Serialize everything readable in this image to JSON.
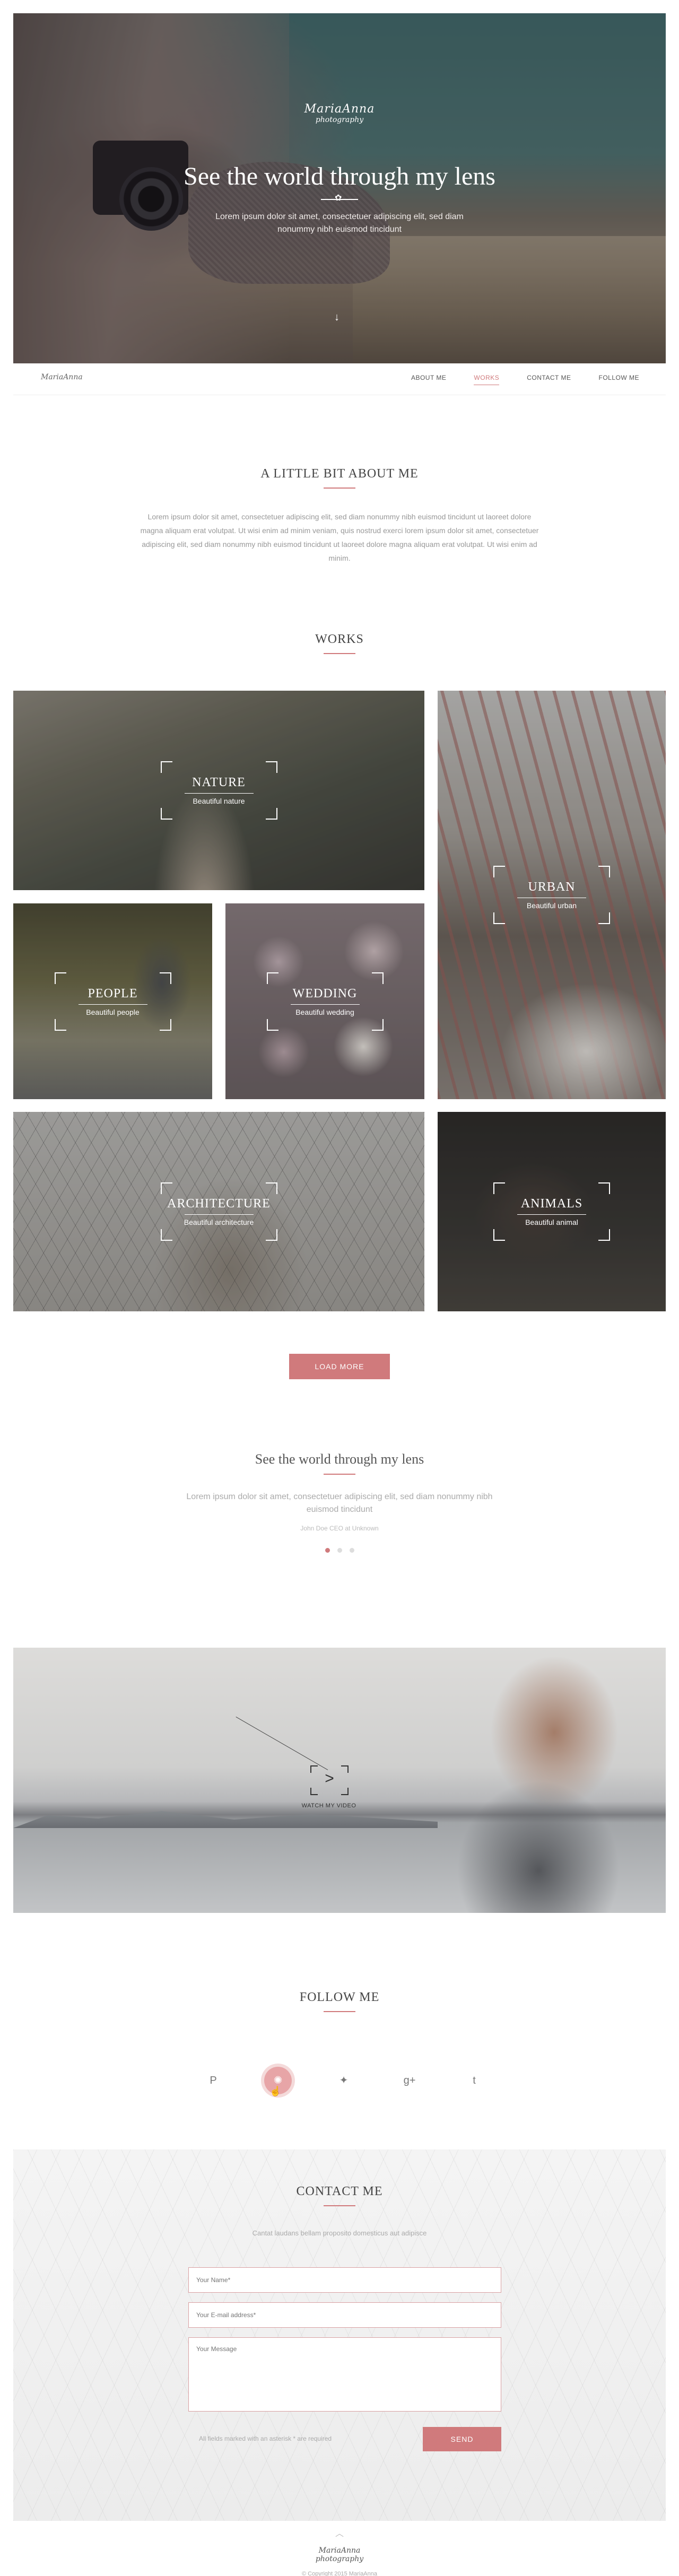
{
  "hero": {
    "logo_line1": "MariaAnna",
    "logo_line2": "photography",
    "title": "See the world through my lens",
    "subtitle": "Lorem ipsum dolor sit amet, consectetuer adipiscing elit, sed diam nonummy nibh euismod tincidunt",
    "scroll_icon": "arrow-down-icon"
  },
  "nav": {
    "brand": "MariaAnna",
    "items": [
      {
        "label": "ABOUT ME"
      },
      {
        "label": "WORKS"
      },
      {
        "label": "CONTACT ME"
      },
      {
        "label": "FOLLOW ME"
      }
    ],
    "active": "WORKS"
  },
  "about": {
    "title": "A LITTLE BIT ABOUT ME",
    "text": "Lorem ipsum dolor sit amet, consectetuer adipiscing elit, sed diam nonummy nibh euismod tincidunt ut laoreet dolore magna aliquam erat volutpat. Ut wisi enim ad minim veniam, quis nostrud exerci lorem ipsum dolor sit amet, consectetuer adipiscing elit, sed diam nonummy nibh euismod tincidunt ut laoreet dolore magna aliquam erat volutpat. Ut wisi enim ad minim."
  },
  "works": {
    "title": "WORKS",
    "tiles": [
      {
        "title": "NATURE",
        "subtitle": "Beautiful nature"
      },
      {
        "title": "URBAN",
        "subtitle": "Beautiful urban"
      },
      {
        "title": "PEOPLE",
        "subtitle": "Beautiful people"
      },
      {
        "title": "WEDDING",
        "subtitle": "Beautiful wedding"
      },
      {
        "title": "ARCHITECTURE",
        "subtitle": "Beautiful architecture"
      },
      {
        "title": "ANIMALS",
        "subtitle": "Beautiful animal"
      }
    ],
    "load_more": "LOAD MORE"
  },
  "testimonial": {
    "title": "See the world through my lens",
    "quote": "Lorem ipsum dolor sit amet, consectetuer adipiscing elit, sed diam nonummy nibh euismod tincidunt",
    "author": "John Doe CEO at Unknown",
    "slides": 3,
    "active_slide": 1
  },
  "video": {
    "play_glyph": ">",
    "label": "WATCH MY VIDEO"
  },
  "follow": {
    "title": "FOLLOW ME",
    "networks": [
      {
        "icon": "pinterest-icon",
        "glyph": "P"
      },
      {
        "icon": "dribbble-icon",
        "glyph": "✺"
      },
      {
        "icon": "twitter-icon",
        "glyph": "✦"
      },
      {
        "icon": "google-plus-icon",
        "glyph": "g+"
      },
      {
        "icon": "tumblr-icon",
        "glyph": "t"
      }
    ],
    "active_network": "dribbble-icon"
  },
  "contact": {
    "title": "CONTACT ME",
    "intro": "Cantat laudans bellam proposito domesticus aut adipisce",
    "name_placeholder": "Your Name*",
    "email_placeholder": "Your E-mail address*",
    "message_placeholder": "Your Message",
    "note": "All fields marked with an asterisk * are required",
    "send": "SEND"
  },
  "footer": {
    "up_icon": "arrow-up-icon",
    "brand_line1": "MariaAnna",
    "brand_line2": "photography",
    "copyright": "© Copyright 2015 MariaAnna"
  },
  "colors": {
    "accent": "#d07a7c",
    "text": "#444444",
    "muted": "#999999"
  }
}
